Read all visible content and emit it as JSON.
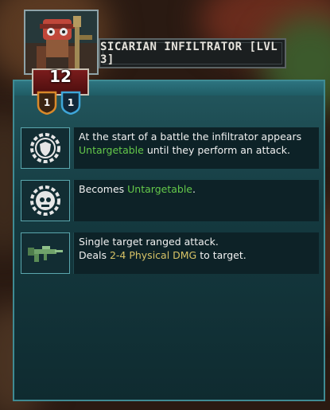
{
  "unit": {
    "name": "SICARIAN INFILTRATOR [LVL 3]",
    "level": "12",
    "rank_badge": "1",
    "tier_badge": "1"
  },
  "abilities": [
    {
      "icon": "shield-gear-icon",
      "line1": "At the start of a battle the infiltrator appears",
      "line2_highlight": "Untargetable",
      "line2_rest": " until they perform an attack."
    },
    {
      "icon": "skull-gear-icon",
      "line1_prefix": "Becomes ",
      "line1_highlight": "Untargetable",
      "line1_suffix": "."
    },
    {
      "icon": "rifle-icon",
      "line1": "Single target ranged attack.",
      "line2_prefix": "Deals ",
      "line2_highlight": "2-4 Physical DMG",
      "line2_suffix": " to target."
    }
  ],
  "colors": {
    "panel": "#1b4a50",
    "panel_border": "#3f8b93",
    "highlight_green": "#64c84a",
    "highlight_gold": "#d6c266",
    "level_banner": "#6a1818"
  }
}
